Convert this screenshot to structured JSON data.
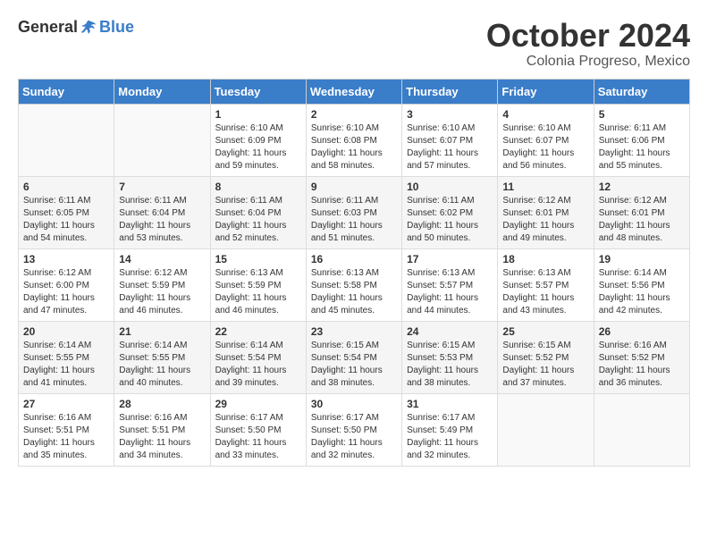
{
  "header": {
    "logo_general": "General",
    "logo_blue": "Blue",
    "month_title": "October 2024",
    "subtitle": "Colonia Progreso, Mexico"
  },
  "weekdays": [
    "Sunday",
    "Monday",
    "Tuesday",
    "Wednesday",
    "Thursday",
    "Friday",
    "Saturday"
  ],
  "weeks": [
    [
      {
        "day": "",
        "info": ""
      },
      {
        "day": "",
        "info": ""
      },
      {
        "day": "1",
        "info": "Sunrise: 6:10 AM\nSunset: 6:09 PM\nDaylight: 11 hours and 59 minutes."
      },
      {
        "day": "2",
        "info": "Sunrise: 6:10 AM\nSunset: 6:08 PM\nDaylight: 11 hours and 58 minutes."
      },
      {
        "day": "3",
        "info": "Sunrise: 6:10 AM\nSunset: 6:07 PM\nDaylight: 11 hours and 57 minutes."
      },
      {
        "day": "4",
        "info": "Sunrise: 6:10 AM\nSunset: 6:07 PM\nDaylight: 11 hours and 56 minutes."
      },
      {
        "day": "5",
        "info": "Sunrise: 6:11 AM\nSunset: 6:06 PM\nDaylight: 11 hours and 55 minutes."
      }
    ],
    [
      {
        "day": "6",
        "info": "Sunrise: 6:11 AM\nSunset: 6:05 PM\nDaylight: 11 hours and 54 minutes."
      },
      {
        "day": "7",
        "info": "Sunrise: 6:11 AM\nSunset: 6:04 PM\nDaylight: 11 hours and 53 minutes."
      },
      {
        "day": "8",
        "info": "Sunrise: 6:11 AM\nSunset: 6:04 PM\nDaylight: 11 hours and 52 minutes."
      },
      {
        "day": "9",
        "info": "Sunrise: 6:11 AM\nSunset: 6:03 PM\nDaylight: 11 hours and 51 minutes."
      },
      {
        "day": "10",
        "info": "Sunrise: 6:11 AM\nSunset: 6:02 PM\nDaylight: 11 hours and 50 minutes."
      },
      {
        "day": "11",
        "info": "Sunrise: 6:12 AM\nSunset: 6:01 PM\nDaylight: 11 hours and 49 minutes."
      },
      {
        "day": "12",
        "info": "Sunrise: 6:12 AM\nSunset: 6:01 PM\nDaylight: 11 hours and 48 minutes."
      }
    ],
    [
      {
        "day": "13",
        "info": "Sunrise: 6:12 AM\nSunset: 6:00 PM\nDaylight: 11 hours and 47 minutes."
      },
      {
        "day": "14",
        "info": "Sunrise: 6:12 AM\nSunset: 5:59 PM\nDaylight: 11 hours and 46 minutes."
      },
      {
        "day": "15",
        "info": "Sunrise: 6:13 AM\nSunset: 5:59 PM\nDaylight: 11 hours and 46 minutes."
      },
      {
        "day": "16",
        "info": "Sunrise: 6:13 AM\nSunset: 5:58 PM\nDaylight: 11 hours and 45 minutes."
      },
      {
        "day": "17",
        "info": "Sunrise: 6:13 AM\nSunset: 5:57 PM\nDaylight: 11 hours and 44 minutes."
      },
      {
        "day": "18",
        "info": "Sunrise: 6:13 AM\nSunset: 5:57 PM\nDaylight: 11 hours and 43 minutes."
      },
      {
        "day": "19",
        "info": "Sunrise: 6:14 AM\nSunset: 5:56 PM\nDaylight: 11 hours and 42 minutes."
      }
    ],
    [
      {
        "day": "20",
        "info": "Sunrise: 6:14 AM\nSunset: 5:55 PM\nDaylight: 11 hours and 41 minutes."
      },
      {
        "day": "21",
        "info": "Sunrise: 6:14 AM\nSunset: 5:55 PM\nDaylight: 11 hours and 40 minutes."
      },
      {
        "day": "22",
        "info": "Sunrise: 6:14 AM\nSunset: 5:54 PM\nDaylight: 11 hours and 39 minutes."
      },
      {
        "day": "23",
        "info": "Sunrise: 6:15 AM\nSunset: 5:54 PM\nDaylight: 11 hours and 38 minutes."
      },
      {
        "day": "24",
        "info": "Sunrise: 6:15 AM\nSunset: 5:53 PM\nDaylight: 11 hours and 38 minutes."
      },
      {
        "day": "25",
        "info": "Sunrise: 6:15 AM\nSunset: 5:52 PM\nDaylight: 11 hours and 37 minutes."
      },
      {
        "day": "26",
        "info": "Sunrise: 6:16 AM\nSunset: 5:52 PM\nDaylight: 11 hours and 36 minutes."
      }
    ],
    [
      {
        "day": "27",
        "info": "Sunrise: 6:16 AM\nSunset: 5:51 PM\nDaylight: 11 hours and 35 minutes."
      },
      {
        "day": "28",
        "info": "Sunrise: 6:16 AM\nSunset: 5:51 PM\nDaylight: 11 hours and 34 minutes."
      },
      {
        "day": "29",
        "info": "Sunrise: 6:17 AM\nSunset: 5:50 PM\nDaylight: 11 hours and 33 minutes."
      },
      {
        "day": "30",
        "info": "Sunrise: 6:17 AM\nSunset: 5:50 PM\nDaylight: 11 hours and 32 minutes."
      },
      {
        "day": "31",
        "info": "Sunrise: 6:17 AM\nSunset: 5:49 PM\nDaylight: 11 hours and 32 minutes."
      },
      {
        "day": "",
        "info": ""
      },
      {
        "day": "",
        "info": ""
      }
    ]
  ]
}
